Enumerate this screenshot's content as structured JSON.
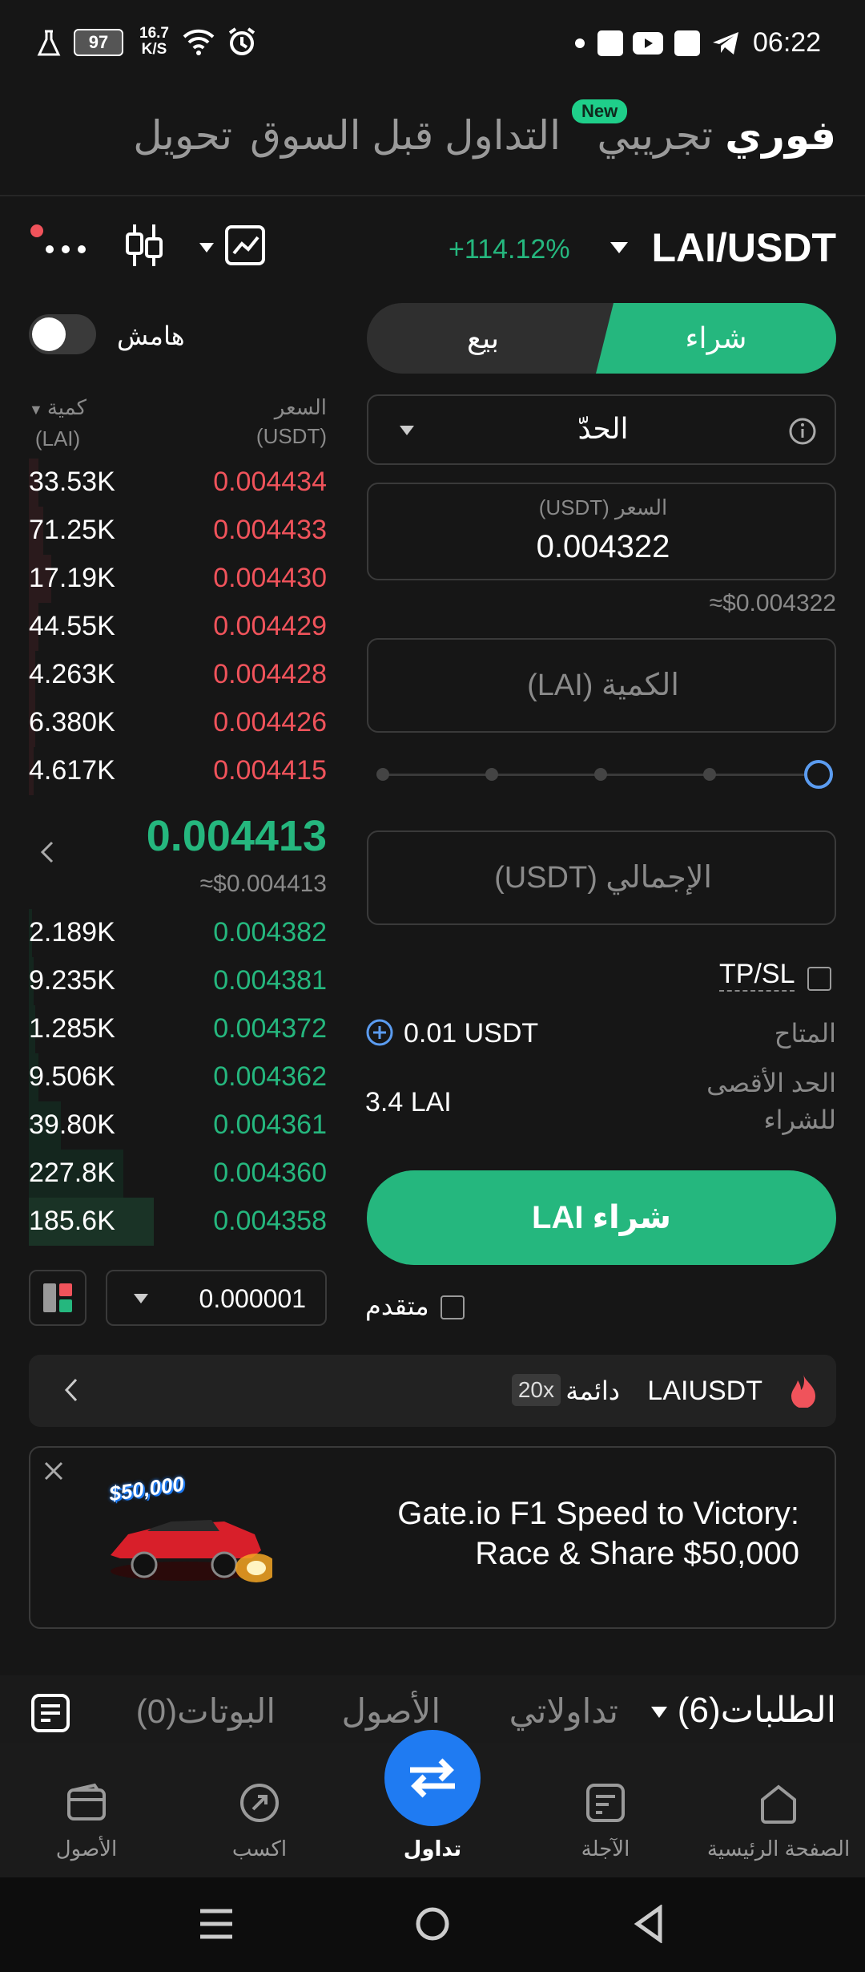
{
  "status_bar": {
    "battery": "97",
    "net_speed_value": "16.7",
    "net_speed_unit": "K/S",
    "time": "06:22"
  },
  "top_tabs": {
    "spot": "فوري",
    "demo": "تجريبي",
    "demo_badge": "New",
    "premarket": "التداول قبل السوق",
    "convert": "تحويل"
  },
  "pair": {
    "name": "LAI/USDT",
    "change": "+114.12%"
  },
  "margin_label": "هامش",
  "order_side": {
    "buy": "شراء",
    "sell": "بيع"
  },
  "order_type": "الحدّ",
  "price_input": {
    "label": "السعر (USDT)",
    "value": "0.004322",
    "usd_equiv": "≈$0.004322"
  },
  "amount_placeholder": "الكمية (LAI)",
  "total_placeholder": "الإجمالي (USDT)",
  "tpsl_label": "TP/SL",
  "available": {
    "label": "المتاح",
    "value": "0.01 USDT"
  },
  "max_buy": {
    "label": "الحد الأقصى للشراء",
    "value": "3.4 LAI"
  },
  "buy_button": "شراء LAI",
  "advanced_label": "متقدم",
  "orderbook": {
    "qty_header_line1": "كمية",
    "qty_header_line2": "(LAI)",
    "price_header_line1": "السعر",
    "price_header_line2": "(USDT)",
    "asks": [
      {
        "qty": "33.53K",
        "price": "0.004434"
      },
      {
        "qty": "71.25K",
        "price": "0.004433"
      },
      {
        "qty": "17.19K",
        "price": "0.004430"
      },
      {
        "qty": "44.55K",
        "price": "0.004429"
      },
      {
        "qty": "4.263K",
        "price": "0.004428"
      },
      {
        "qty": "6.380K",
        "price": "0.004426"
      },
      {
        "qty": "4.617K",
        "price": "0.004415"
      }
    ],
    "last_price": "0.004413",
    "last_price_usd": "≈$0.004413",
    "bids": [
      {
        "qty": "2.189K",
        "price": "0.004382"
      },
      {
        "qty": "9.235K",
        "price": "0.004381"
      },
      {
        "qty": "1.285K",
        "price": "0.004372"
      },
      {
        "qty": "9.506K",
        "price": "0.004362"
      },
      {
        "qty": "39.80K",
        "price": "0.004361"
      },
      {
        "qty": "227.8K",
        "price": "0.004360"
      },
      {
        "qty": "185.6K",
        "price": "0.004358"
      }
    ],
    "precision": "0.000001"
  },
  "perp_banner": {
    "symbol": "LAIUSDT",
    "type": "دائمة",
    "leverage": "20x"
  },
  "promo": {
    "line1": "Gate.io F1 Speed to Victory:",
    "line2": "Race & Share $50,000",
    "image_text": "$50,000"
  },
  "bottom_tabs": {
    "orders": "الطلبات(6)",
    "trades": "تداولاتي",
    "assets": "الأصول",
    "bots": "البوتات(0)"
  },
  "bottom_nav": {
    "home": "الصفحة الرئيسية",
    "futures": "الآجلة",
    "trade": "تداول",
    "earn": "اكسب",
    "assets": "الأصول"
  },
  "colors": {
    "green": "#25b77e",
    "red": "#f0535b",
    "accent_blue": "#1f7bf2",
    "background": "#161616"
  }
}
